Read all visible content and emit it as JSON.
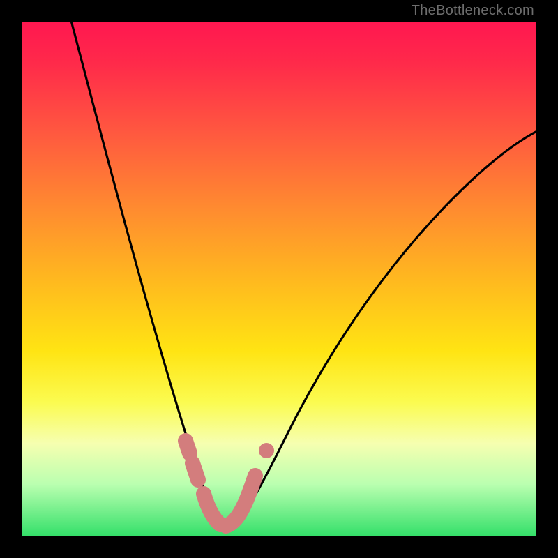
{
  "watermark": "TheBottleneck.com",
  "chart_data": {
    "type": "line",
    "title": "",
    "xlabel": "",
    "ylabel": "",
    "xlim": [
      0,
      100
    ],
    "ylim": [
      0,
      100
    ],
    "grid": false,
    "legend": false,
    "series": [
      {
        "name": "bottleneck-curve",
        "x": [
          10,
          14,
          18,
          22,
          26,
          30,
          33,
          35,
          37,
          39,
          42,
          46,
          52,
          60,
          70,
          80,
          90,
          100
        ],
        "values": [
          100,
          80,
          62,
          46,
          32,
          20,
          12,
          7,
          4,
          4,
          5,
          9,
          17,
          28,
          42,
          56,
          68,
          78
        ]
      }
    ],
    "annotations": [
      {
        "name": "highlight-segment-left",
        "x": [
          32,
          33,
          34
        ],
        "values": [
          16,
          12,
          9
        ]
      },
      {
        "name": "highlight-segment-bottom",
        "x": [
          35,
          37,
          39,
          41,
          43
        ],
        "values": [
          5,
          4,
          4,
          5,
          7
        ]
      },
      {
        "name": "highlight-dot-upper-right",
        "x": [
          45
        ],
        "values": [
          13
        ]
      }
    ],
    "background_gradient_stops": [
      {
        "pos": 0,
        "color": "#ff1750"
      },
      {
        "pos": 22,
        "color": "#ff5a3f"
      },
      {
        "pos": 50,
        "color": "#ffb81f"
      },
      {
        "pos": 74,
        "color": "#fbfb50"
      },
      {
        "pos": 90,
        "color": "#baffb0"
      },
      {
        "pos": 100,
        "color": "#35e06a"
      }
    ]
  }
}
